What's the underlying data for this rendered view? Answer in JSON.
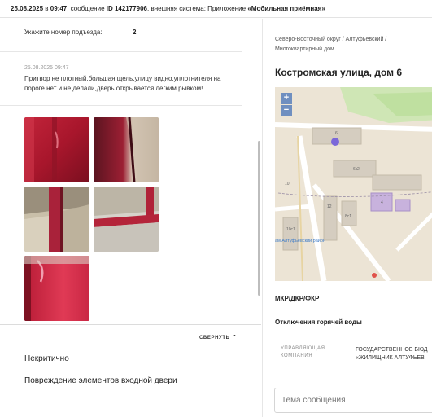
{
  "header": {
    "date": "25.08.2025",
    "time_prefix": " в ",
    "time": "09:47",
    "msg_prefix": ", сообщение ",
    "id_label": "ID 142177906",
    "system_prefix": ", внешняя система: Приложение ",
    "app_name": "«Мобильная приёмная»"
  },
  "entrance": {
    "label": "Укажите номер подъезда:",
    "value": "2"
  },
  "comment": {
    "date": "25.08.2025 09:47",
    "text": "Притвор не плотный,большая щель,улицу видно,уплотнителя на пороге нет и не делали,дверь открывается лёгким рывком!"
  },
  "photos": [
    "photo-1",
    "photo-2",
    "photo-3",
    "photo-4",
    "photo-5"
  ],
  "bottom": {
    "collapse_label": "СВЕРНУТЬ",
    "priority": "Некритично",
    "category": "Повреждение элементов входной двери"
  },
  "right": {
    "breadcrumb": "Северо-Восточный округ / Алтуфьевский / Многоквартирный дом",
    "address": "Костромская улица, дом 6",
    "map": {
      "zoom_in": "+",
      "zoom_out": "−",
      "labels": {
        "b6": "6",
        "b6k2": "6к2",
        "b10": "10",
        "b12": "12",
        "b8": "8с1",
        "b4": "4",
        "b10b": "10с1",
        "district": "ам Алтуфьевский район"
      }
    },
    "mkr_label": "МКР/ДКР/ФКР",
    "hot_water_label": "Отключения горячей воды",
    "mc_label": "УПРАВЛЯЮЩАЯ КОМПАНИЯ",
    "mc_value_line1": "ГОСУДАРСТВЕННОЕ БЮД",
    "mc_value_line2": "«ЖИЛИЩНИК АЛТУФЬЕВ",
    "message_placeholder": "Тема сообщения"
  }
}
